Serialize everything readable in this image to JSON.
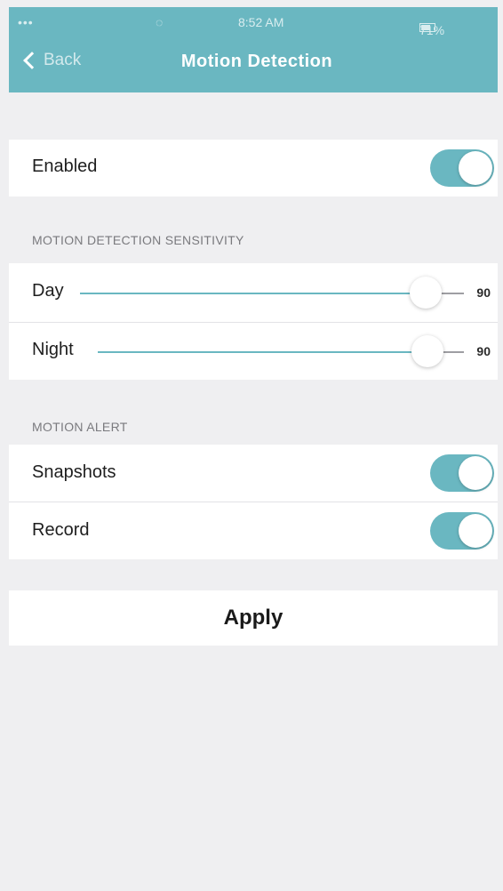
{
  "status_bar": {
    "signal": "•••",
    "wifi": "◌",
    "time": "8:52 AM",
    "battery": "71%"
  },
  "nav": {
    "back_label": "Back",
    "title": "Motion Detection"
  },
  "enabled": {
    "label": "Enabled",
    "on": true
  },
  "sensitivity": {
    "header": "MOTION DETECTION SENSITIVITY",
    "max": 100,
    "day": {
      "label": "Day",
      "value": "90",
      "level": 90
    },
    "night": {
      "label": "Night",
      "value": "90",
      "level": 90
    }
  },
  "alert": {
    "header": "MOTION ALERT",
    "snapshots": {
      "label": "Snapshots",
      "on": true
    },
    "record": {
      "label": "Record",
      "on": true
    }
  },
  "apply_label": "Apply",
  "colors": {
    "accent": "#6ab7c1",
    "background": "#efeff1",
    "row": "#ffffff",
    "section_text": "#7a7a7e"
  }
}
